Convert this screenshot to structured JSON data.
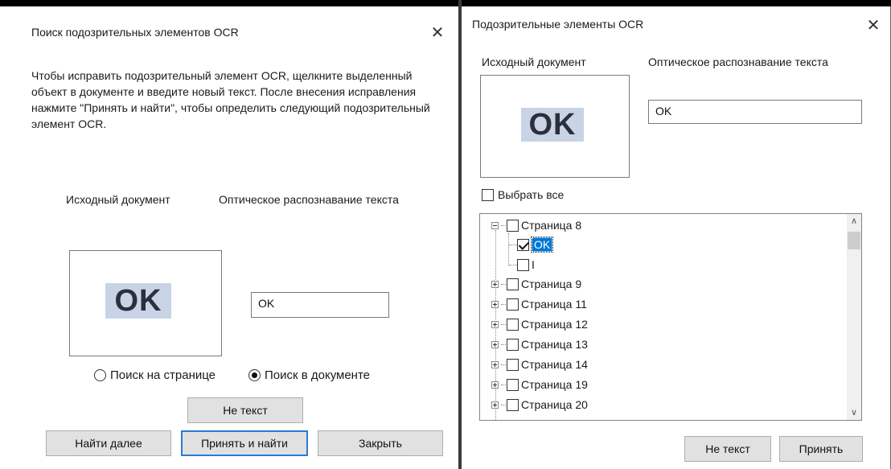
{
  "left_dialog": {
    "title": "Поиск подозрительных элементов OCR",
    "close_glyph": "✕",
    "instructions": "Чтобы исправить подозрительный элемент OCR, щелкните выделенный объект в документе и введите новый текст. После внесения исправления нажмите \"Принять и найти\", чтобы определить следующий подозрительный элемент OCR.",
    "source_label": "Исходный документ",
    "ocr_label": "Оптическое распознавание текста",
    "preview_image_text": "OK",
    "ocr_value": "OK",
    "radio_page": {
      "label": "Поиск на странице",
      "checked": false
    },
    "radio_document": {
      "label": "Поиск в документе",
      "checked": true
    },
    "not_text_button": "Не текст",
    "find_next_button": "Найти далее",
    "accept_find_button": "Принять и найти",
    "close_button": "Закрыть"
  },
  "right_dialog": {
    "title": "Подозрительные элементы OCR",
    "close_glyph": "✕",
    "source_label": "Исходный документ",
    "ocr_label": "Оптическое распознавание текста",
    "preview_image_text": "OK",
    "ocr_value": "OK",
    "select_all_label": "Выбрать все",
    "tree": [
      {
        "label": "Страница 8",
        "level": 0,
        "checked": false,
        "expanded": true
      },
      {
        "label": "OK",
        "level": 1,
        "checked": true,
        "selected": true
      },
      {
        "label": "I",
        "level": 1,
        "checked": false
      },
      {
        "label": "Страница 9",
        "level": 0,
        "checked": false,
        "expanded": false
      },
      {
        "label": "Страница 11",
        "level": 0,
        "checked": false,
        "expanded": false
      },
      {
        "label": "Страница 12",
        "level": 0,
        "checked": false,
        "expanded": false
      },
      {
        "label": "Страница 13",
        "level": 0,
        "checked": false,
        "expanded": false
      },
      {
        "label": "Страница 14",
        "level": 0,
        "checked": false,
        "expanded": false
      },
      {
        "label": "Страница 19",
        "level": 0,
        "checked": false,
        "expanded": false
      },
      {
        "label": "Страница 20",
        "level": 0,
        "checked": false,
        "expanded": false
      }
    ],
    "not_text_button": "Не текст",
    "accept_button": "Принять",
    "scroll_up_glyph": "∧",
    "scroll_down_glyph": "∨"
  }
}
